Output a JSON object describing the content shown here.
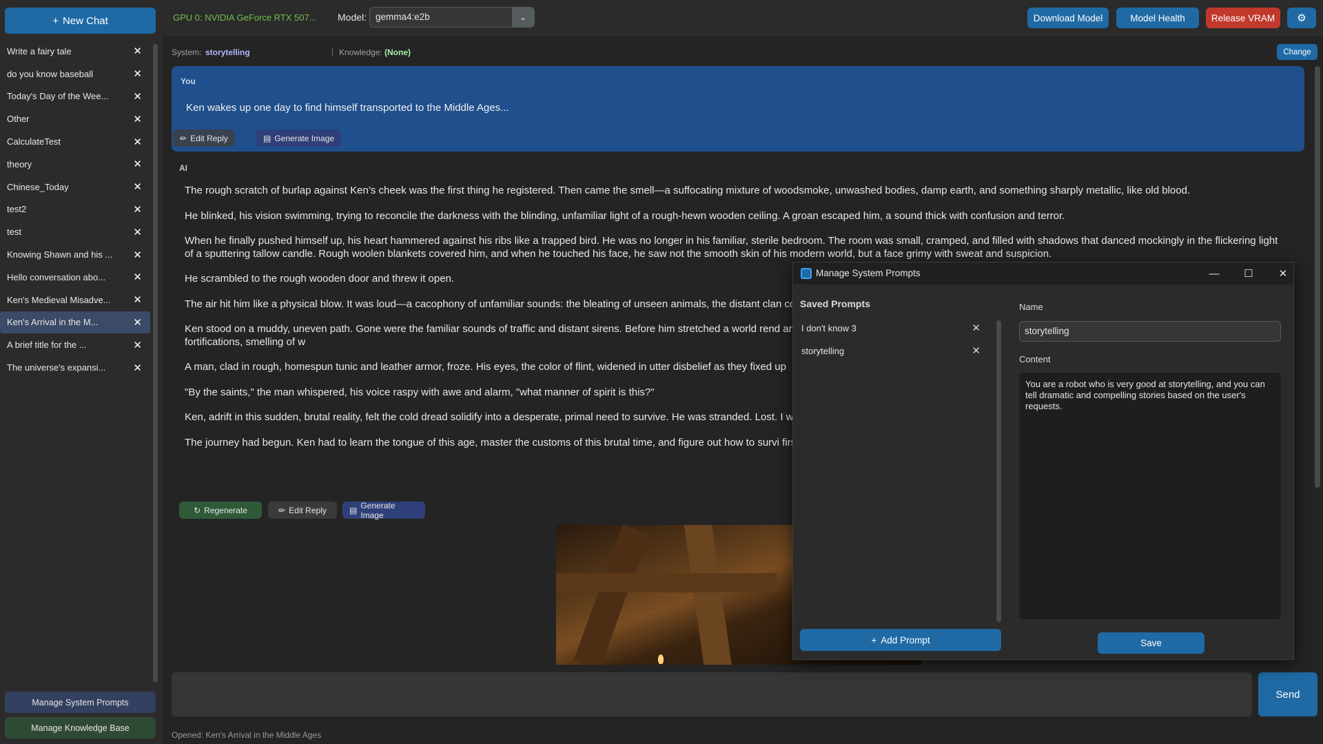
{
  "sidebar": {
    "new_chat_label": "New Chat",
    "chats": [
      {
        "title": "Write a fairy tale",
        "active": false
      },
      {
        "title": "do you know baseball",
        "active": false
      },
      {
        "title": "Today's Day of the Wee...",
        "active": false
      },
      {
        "title": "Other",
        "active": false
      },
      {
        "title": "CalculateTest",
        "active": false
      },
      {
        "title": "theory",
        "active": false
      },
      {
        "title": "Chinese_Today",
        "active": false
      },
      {
        "title": "test2",
        "active": false
      },
      {
        "title": "test",
        "active": false
      },
      {
        "title": "Knowing Shawn and his ...",
        "active": false
      },
      {
        "title": "Hello conversation abo...",
        "active": false
      },
      {
        "title": "Ken's Medieval Misadve...",
        "active": false
      },
      {
        "title": "Ken's Arrival in the M...",
        "active": true
      },
      {
        "title": "A brief title for the ...",
        "active": false
      },
      {
        "title": "The universe's expansi...",
        "active": false
      }
    ],
    "close_glyph": "✕",
    "manage_system_prompts": "Manage System Prompts",
    "manage_knowledge_base": "Manage Knowledge Base"
  },
  "topbar": {
    "gpu": "GPU 0: NVIDIA GeForce RTX 507...",
    "model_label": "Model:",
    "model_value": "gemma4:e2b",
    "download_model": "Download Model",
    "model_health": "Model Health",
    "release_vram": "Release VRAM",
    "settings_icon": "gear-icon"
  },
  "system_line": {
    "system_label": "System:",
    "system_value": "storytelling",
    "knowledge_label": "Knowledge:",
    "knowledge_value": "(None)",
    "change": "Change"
  },
  "conversation": {
    "user_label": "You",
    "user_message": "Ken wakes up one day to find himself transported to the Middle Ages...",
    "user_edit": "Edit Reply",
    "user_generate_image": "Generate Image",
    "ai_label": "AI",
    "ai_paragraphs": [
      "The rough scratch of burlap against Ken’s cheek was the first thing he registered. Then came the smell—a suffocating mixture of woodsmoke, unwashed bodies, damp earth, and something sharply metallic, like old blood.",
      "He blinked, his vision swimming, trying to reconcile the darkness with the blinding, unfamiliar light of a rough-hewn wooden ceiling. A groan escaped him, a sound thick with confusion and terror.",
      "When he finally pushed himself up, his heart hammered against his ribs like a trapped bird. He was no longer in his familiar, sterile bedroom. The room was small, cramped, and filled with shadows that danced mockingly in the flickering light of a sputtering tallow candle. Rough woolen blankets covered him, and when he touched his face, he saw not the smooth skin of his modern world, but a face grimy with sweat and suspicion.",
      "He scrambled to the rough wooden door and threw it open.",
      "The air hit him like a physical blow. It was loud—a cacophony of unfamiliar sounds: the bleating of unseen animals, the distant clan conspiratorial murmur of fear.",
      "Ken stood on a muddy, uneven path. Gone were the familiar sounds of traffic and distant sirens. Before him stretched a world rend and a dense, ancient forest pressing in on all sides. Towering above the trees were crude, sturdy wooden fortifications, smelling of w",
      "A man, clad in rough, homespun tunic and leather armor, froze. His eyes, the color of flint, widened in utter disbelief as they fixed up",
      "\"By the saints,\" the man whispered, his voice raspy with awe and alarm, \"what manner of spirit is this?\"",
      "Ken, adrift in this sudden, brutal reality, felt the cold dread solidify into a desperate, primal need to survive. He was stranded. Lost. I where every shadow held a potential threat, and every breath was a gamble against the unknown.",
      "The journey had begun. Ken had to learn the tongue of this age, master the customs of this brutal time, and figure out how to survi first, terrifying step he took into the dawn of the Middle Ages."
    ],
    "regenerate": "Regenerate",
    "ai_edit": "Edit Reply",
    "ai_generate_image": "Generate Image"
  },
  "input": {
    "placeholder": "",
    "send": "Send"
  },
  "status": "Opened: Ken's Arrival in the Middle Ages",
  "dialog": {
    "title": "Manage System Prompts",
    "saved_prompts_heading": "Saved Prompts",
    "prompts": [
      "I don't know 3",
      "storytelling"
    ],
    "add_prompt": "Add Prompt",
    "name_label": "Name",
    "name_value": "storytelling",
    "content_label": "Content",
    "content_value": "You are a robot who is very good at storytelling, and you can tell dramatic and compelling stories based on the user's requests.",
    "save": "Save"
  },
  "colors": {
    "accent": "#1f6aa5",
    "danger": "#c0392b",
    "gpu_text": "#6fbf4a",
    "user_bubble": "#1f4f8c"
  }
}
